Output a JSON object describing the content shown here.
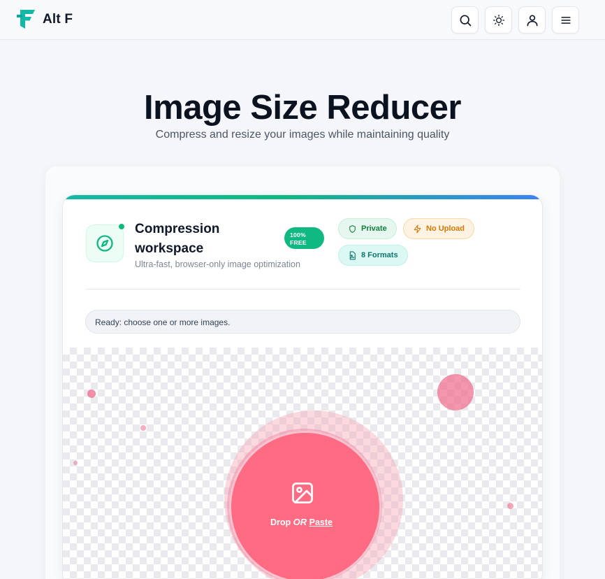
{
  "header": {
    "brand": "Alt F",
    "icons": [
      "search-icon",
      "sun-icon",
      "user-icon",
      "menu-icon"
    ]
  },
  "hero": {
    "title": "Image Size Reducer",
    "subtitle": "Compress and resize your images while maintaining quality"
  },
  "workspace": {
    "title": "Compression workspace",
    "subtitle": "Ultra-fast, browser-only image optimization",
    "badge_line1": "100%",
    "badge_line2": "FREE",
    "chips": {
      "private": "Private",
      "no_upload": "No Upload",
      "formats": "8 Formats"
    },
    "status": "Ready: choose one or more images."
  },
  "dropzone": {
    "drop": "Drop",
    "or": "OR",
    "paste": "Paste"
  },
  "colors": {
    "brand": "#14b8a6",
    "accent_green": "#10b981",
    "drop_pink": "#fe6b82",
    "warning": "#d97706"
  }
}
